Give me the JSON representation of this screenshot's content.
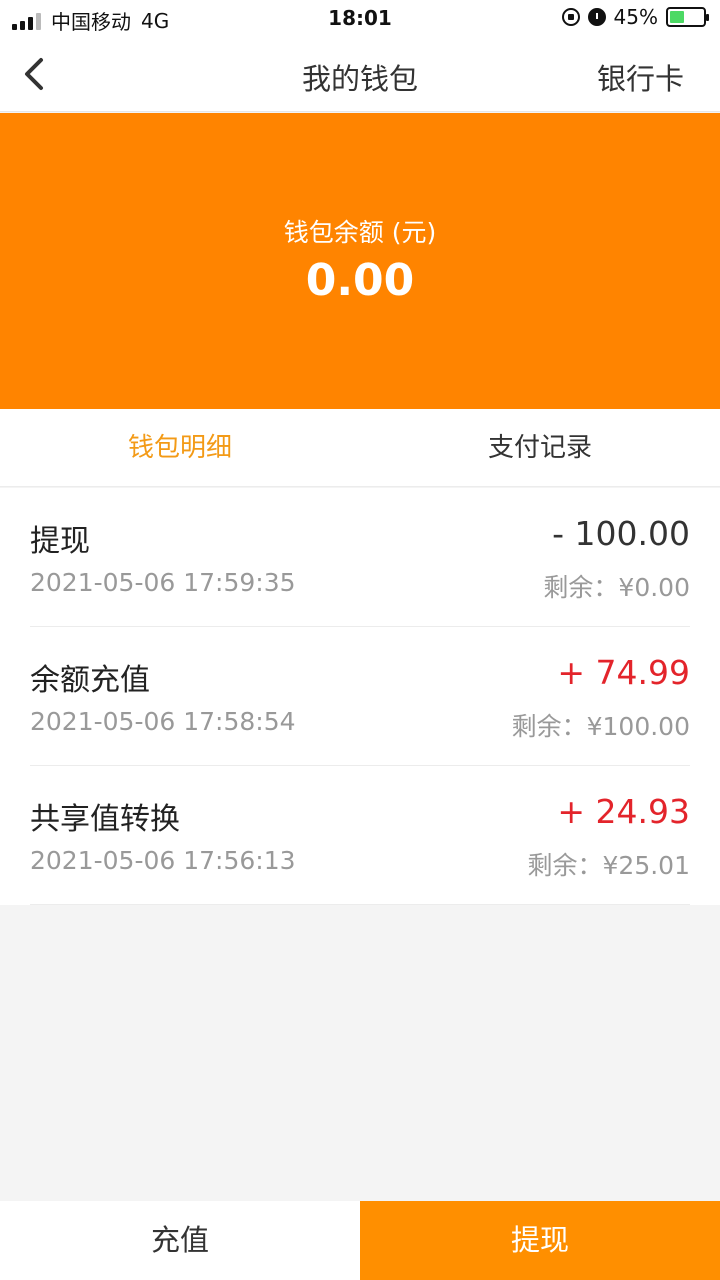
{
  "status_bar": {
    "carrier": "中国移动",
    "network": "4G",
    "time": "18:01",
    "battery": "45%",
    "battery_level": 0.45
  },
  "nav": {
    "title": "我的钱包",
    "right_link": "银行卡",
    "back_icon": "chevron-left-icon"
  },
  "wallet": {
    "balance_label": "钱包余额 (元)",
    "balance": "0.00"
  },
  "tabs": [
    {
      "label": "钱包明细",
      "active": true
    },
    {
      "label": "支付记录",
      "active": false
    }
  ],
  "records": [
    {
      "title": "提现",
      "time": "2021-05-06 17:59:35",
      "amount": "- 100.00",
      "remaining": "剩余：¥0.00"
    },
    {
      "title": "余额充值",
      "time": "2021-05-06 17:58:54",
      "amount": "+ 74.99",
      "remaining": "剩余：¥100.00"
    },
    {
      "title": "共享值转换",
      "time": "2021-05-06 17:56:13",
      "amount": "+ 24.93",
      "remaining": "剩余：¥25.01"
    }
  ],
  "bottom": {
    "recharge_label": "充值",
    "withdraw_label": "提现"
  },
  "colors": {
    "accent": "#ff8400",
    "active_tab": "#f39a16",
    "income": "#e3242b"
  }
}
